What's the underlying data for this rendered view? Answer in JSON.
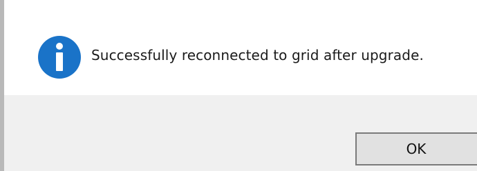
{
  "dialog": {
    "icon": "info-icon",
    "message": "Successfully reconnected to grid after upgrade.",
    "ok_label": "OK"
  },
  "colors": {
    "icon_blue": "#1a73c8",
    "footer_bg": "#f0f0f0",
    "button_bg": "#e1e1e1",
    "button_border": "#7a7a7a"
  }
}
